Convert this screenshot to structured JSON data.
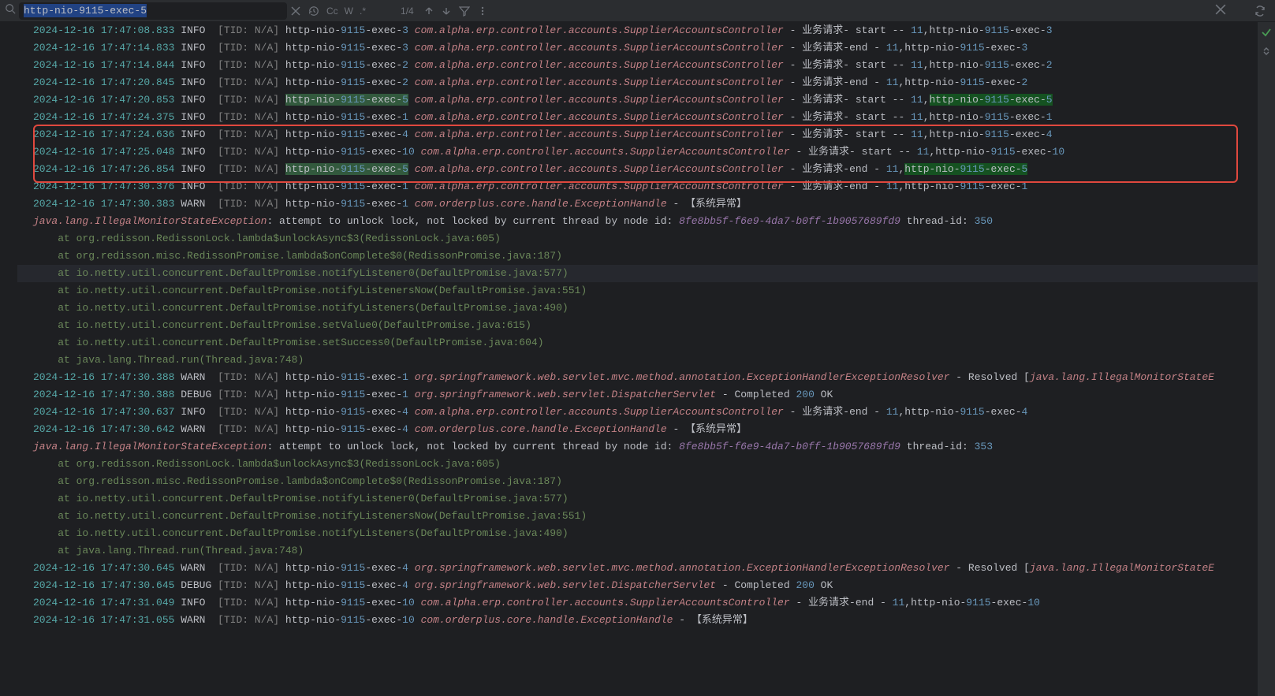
{
  "search": {
    "query": "http-nio-9115-exec-5",
    "case_label": "Cc",
    "word_label": "W",
    "regex_label": ".*",
    "counter": "1/4"
  },
  "lines": [
    {
      "raw": "2024-12-16 17:47:08.833",
      "lvl": "INFO ",
      "thread": "http-nio-",
      "port": "9115",
      "en": "-exec-",
      "tn": "3",
      "cls": "com.alpha.erp.controller.accounts.SupplierAccountsController",
      "msg": " - 业务请求- start -- ",
      "na": "11",
      "tail": ",http-nio-",
      "port2": "9115",
      "en2": "-exec-",
      "tn2": "3"
    },
    {
      "raw": "2024-12-16 17:47:14.833",
      "lvl": "INFO ",
      "thread": "http-nio-",
      "port": "9115",
      "en": "-exec-",
      "tn": "3",
      "cls": "com.alpha.erp.controller.accounts.SupplierAccountsController",
      "msg": " - 业务请求-end - ",
      "na": "11",
      "tail": ",http-nio-",
      "port2": "9115",
      "en2": "-exec-",
      "tn2": "3"
    },
    {
      "raw": "2024-12-16 17:47:14.844",
      "lvl": "INFO ",
      "thread": "http-nio-",
      "port": "9115",
      "en": "-exec-",
      "tn": "2",
      "cls": "com.alpha.erp.controller.accounts.SupplierAccountsController",
      "msg": " - 业务请求- start -- ",
      "na": "11",
      "tail": ",http-nio-",
      "port2": "9115",
      "en2": "-exec-",
      "tn2": "2"
    },
    {
      "raw": "2024-12-16 17:47:20.845",
      "lvl": "INFO ",
      "thread": "http-nio-",
      "port": "9115",
      "en": "-exec-",
      "tn": "2",
      "cls": "com.alpha.erp.controller.accounts.SupplierAccountsController",
      "msg": " - 业务请求-end - ",
      "na": "11",
      "tail": ",http-nio-",
      "port2": "9115",
      "en2": "-exec-",
      "tn2": "2"
    },
    {
      "raw": "2024-12-16 17:47:20.853",
      "lvl": "INFO ",
      "thread": "http-nio-",
      "port": "9115",
      "en": "-exec-",
      "tn": "5",
      "cls": "com.alpha.erp.controller.accounts.SupplierAccountsController",
      "msg": " - 业务请求- start -- ",
      "na": "11",
      "tail": ",http-nio-",
      "port2": "9115",
      "en2": "-exec-",
      "tn2": "5",
      "hl": true,
      "hltail": true
    },
    {
      "raw": "2024-12-16 17:47:24.375",
      "lvl": "INFO ",
      "thread": "http-nio-",
      "port": "9115",
      "en": "-exec-",
      "tn": "1",
      "cls": "com.alpha.erp.controller.accounts.SupplierAccountsController",
      "msg": " - 业务请求- start -- ",
      "na": "11",
      "tail": ",http-nio-",
      "port2": "9115",
      "en2": "-exec-",
      "tn2": "1"
    },
    {
      "raw": "2024-12-16 17:47:24.636",
      "lvl": "INFO ",
      "thread": "http-nio-",
      "port": "9115",
      "en": "-exec-",
      "tn": "4",
      "cls": "com.alpha.erp.controller.accounts.SupplierAccountsController",
      "msg": " - 业务请求- start -- ",
      "na": "11",
      "tail": ",http-nio-",
      "port2": "9115",
      "en2": "-exec-",
      "tn2": "4"
    },
    {
      "raw": "2024-12-16 17:47:25.048",
      "lvl": "INFO ",
      "thread": "http-nio-",
      "port": "9115",
      "en": "-exec-",
      "tn": "10",
      "cls": "com.alpha.erp.controller.accounts.SupplierAccountsController",
      "msg": " - 业务请求- start -- ",
      "na": "11",
      "tail": ",http-nio-",
      "port2": "9115",
      "en2": "-exec-",
      "tn2": "10"
    },
    {
      "raw": "2024-12-16 17:47:26.854",
      "lvl": "INFO ",
      "thread": "http-nio-",
      "port": "9115",
      "en": "-exec-",
      "tn": "5",
      "cls": "com.alpha.erp.controller.accounts.SupplierAccountsController",
      "msg": " - 业务请求-end - ",
      "na": "11",
      "tail": ",http-nio-",
      "port2": "9115",
      "en2": "-exec-",
      "tn2": "5",
      "hl": true,
      "hltail": true
    },
    {
      "raw": "2024-12-16 17:47:30.376",
      "lvl": "INFO ",
      "thread": "http-nio-",
      "port": "9115",
      "en": "-exec-",
      "tn": "1",
      "cls": "com.alpha.erp.controller.accounts.SupplierAccountsController",
      "msg": " - 业务请求-end - ",
      "na": "11",
      "tail": ",http-nio-",
      "port2": "9115",
      "en2": "-exec-",
      "tn2": "1"
    },
    {
      "raw": "2024-12-16 17:47:30.383",
      "lvl": "WARN ",
      "thread": "http-nio-",
      "port": "9115",
      "en": "-exec-",
      "tn": "1",
      "cls": "com.orderplus.core.handle.ExceptionHandle",
      "msg": " - 【系统异常】"
    },
    {
      "type": "ex",
      "text": "java.lang.IllegalMonitorStateException",
      "exmsg": ": attempt to unlock lock, not locked by current thread by node id: ",
      "hash": "8fe8bb5f-f6e9-4da7-b0ff-1b9057689fd9",
      "tid": " thread-id: ",
      "tidn": "350"
    },
    {
      "type": "stk",
      "text": "    at org.redisson.RedissonLock.lambda$unlockAsync$3(RedissonLock.java:605)"
    },
    {
      "type": "stk",
      "text": "    at org.redisson.misc.RedissonPromise.lambda$onComplete$0(RedissonPromise.java:187)"
    },
    {
      "type": "stk",
      "text": "    at io.netty.util.concurrent.DefaultPromise.notifyListener0(DefaultPromise.java:577)",
      "active": true
    },
    {
      "type": "stk",
      "text": "    at io.netty.util.concurrent.DefaultPromise.notifyListenersNow(DefaultPromise.java:551)"
    },
    {
      "type": "stk",
      "text": "    at io.netty.util.concurrent.DefaultPromise.notifyListeners(DefaultPromise.java:490)"
    },
    {
      "type": "stk",
      "text": "    at io.netty.util.concurrent.DefaultPromise.setValue0(DefaultPromise.java:615)"
    },
    {
      "type": "stk",
      "text": "    at io.netty.util.concurrent.DefaultPromise.setSuccess0(DefaultPromise.java:604)"
    },
    {
      "type": "stk",
      "text": "    at java.lang.Thread.run(Thread.java:748)"
    },
    {
      "raw": "2024-12-16 17:47:30.388",
      "lvl": "WARN ",
      "thread": "http-nio-",
      "port": "9115",
      "en": "-exec-",
      "tn": "1",
      "cls": "org.springframework.web.servlet.mvc.method.annotation.ExceptionHandlerExceptionResolver",
      "msg": " - Resolved [",
      "exref": "java.lang.IllegalMonitorStateE"
    },
    {
      "raw": "2024-12-16 17:47:30.388",
      "lvl": "DEBUG",
      "thread": "http-nio-",
      "port": "9115",
      "en": "-exec-",
      "tn": "1",
      "cls": "org.springframework.web.servlet.DispatcherServlet",
      "msg": " - Completed ",
      "status": "200",
      "ok": " OK"
    },
    {
      "raw": "2024-12-16 17:47:30.637",
      "lvl": "INFO ",
      "thread": "http-nio-",
      "port": "9115",
      "en": "-exec-",
      "tn": "4",
      "cls": "com.alpha.erp.controller.accounts.SupplierAccountsController",
      "msg": " - 业务请求-end - ",
      "na": "11",
      "tail": ",http-nio-",
      "port2": "9115",
      "en2": "-exec-",
      "tn2": "4"
    },
    {
      "raw": "2024-12-16 17:47:30.642",
      "lvl": "WARN ",
      "thread": "http-nio-",
      "port": "9115",
      "en": "-exec-",
      "tn": "4",
      "cls": "com.orderplus.core.handle.ExceptionHandle",
      "msg": " - 【系统异常】"
    },
    {
      "type": "ex",
      "text": "java.lang.IllegalMonitorStateException",
      "exmsg": ": attempt to unlock lock, not locked by current thread by node id: ",
      "hash": "8fe8bb5f-f6e9-4da7-b0ff-1b9057689fd9",
      "tid": " thread-id: ",
      "tidn": "353"
    },
    {
      "type": "stk",
      "text": "    at org.redisson.RedissonLock.lambda$unlockAsync$3(RedissonLock.java:605)"
    },
    {
      "type": "stk",
      "text": "    at org.redisson.misc.RedissonPromise.lambda$onComplete$0(RedissonPromise.java:187)"
    },
    {
      "type": "stk",
      "text": "    at io.netty.util.concurrent.DefaultPromise.notifyListener0(DefaultPromise.java:577)"
    },
    {
      "type": "stk",
      "text": "    at io.netty.util.concurrent.DefaultPromise.notifyListenersNow(DefaultPromise.java:551)"
    },
    {
      "type": "stk",
      "text": "    at io.netty.util.concurrent.DefaultPromise.notifyListeners(DefaultPromise.java:490)"
    },
    {
      "type": "stk",
      "text": "    at java.lang.Thread.run(Thread.java:748)"
    },
    {
      "raw": "2024-12-16 17:47:30.645",
      "lvl": "WARN ",
      "thread": "http-nio-",
      "port": "9115",
      "en": "-exec-",
      "tn": "4",
      "cls": "org.springframework.web.servlet.mvc.method.annotation.ExceptionHandlerExceptionResolver",
      "msg": " - Resolved [",
      "exref": "java.lang.IllegalMonitorStateE"
    },
    {
      "raw": "2024-12-16 17:47:30.645",
      "lvl": "DEBUG",
      "thread": "http-nio-",
      "port": "9115",
      "en": "-exec-",
      "tn": "4",
      "cls": "org.springframework.web.servlet.DispatcherServlet",
      "msg": " - Completed ",
      "status": "200",
      "ok": " OK"
    },
    {
      "raw": "2024-12-16 17:47:31.049",
      "lvl": "INFO ",
      "thread": "http-nio-",
      "port": "9115",
      "en": "-exec-",
      "tn": "10",
      "cls": "com.alpha.erp.controller.accounts.SupplierAccountsController",
      "msg": " - 业务请求-end - ",
      "na": "11",
      "tail": ",http-nio-",
      "port2": "9115",
      "en2": "-exec-",
      "tn2": "10"
    },
    {
      "raw": "2024-12-16 17:47:31.055",
      "lvl": "WARN ",
      "thread": "http-nio-",
      "port": "9115",
      "en": "-exec-",
      "tn": "10",
      "cls": "com.orderplus.core.handle.ExceptionHandle",
      "msg": " - 【系统异常】"
    },
    {
      "type": "blank"
    }
  ]
}
